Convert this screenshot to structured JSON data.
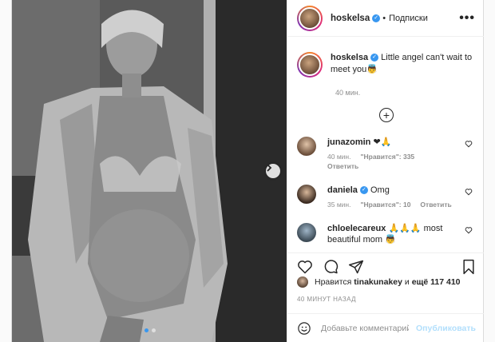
{
  "header": {
    "username": "hoskelsa",
    "separator": "•",
    "follow_label": "Подписки",
    "more_label": "•••"
  },
  "caption": {
    "username": "hoskelsa",
    "text": "Little angel can't wait to meet you👼",
    "time": "40 мин."
  },
  "comments": [
    {
      "username": "junazomin",
      "text": "❤🙏",
      "time": "40 мин.",
      "likes": "\"Нравится\": 335",
      "reply": "Ответить",
      "verified": false
    },
    {
      "username": "daniela",
      "text": "Omg",
      "time": "35 мин.",
      "likes": "\"Нравится\": 10",
      "reply": "Ответить",
      "verified": true
    },
    {
      "username": "chloelecareux",
      "text": "🙏🙏🙏 most beautiful mom 👼",
      "time": "",
      "likes": "",
      "reply": "",
      "verified": false
    }
  ],
  "likes": {
    "prefix": "Нравится",
    "user": "tinakunakey",
    "suffix": "и",
    "rest": "ещё 117 410"
  },
  "posted": "40 МИНУТ НАЗАД",
  "add_comment": {
    "placeholder": "Добавьте комментарий...",
    "publish_label": "Опубликовать"
  },
  "icons": {
    "next": "chevron-right-icon",
    "load_more": "plus-circle-icon",
    "like": "heart-icon",
    "comment": "comment-icon",
    "share": "paper-plane-icon",
    "save": "bookmark-icon",
    "emoji": "smiley-icon"
  },
  "colors": {
    "verified": "#3897f0",
    "publish": "#b2dffc",
    "text": "#262626",
    "muted": "#8e8e8e"
  }
}
